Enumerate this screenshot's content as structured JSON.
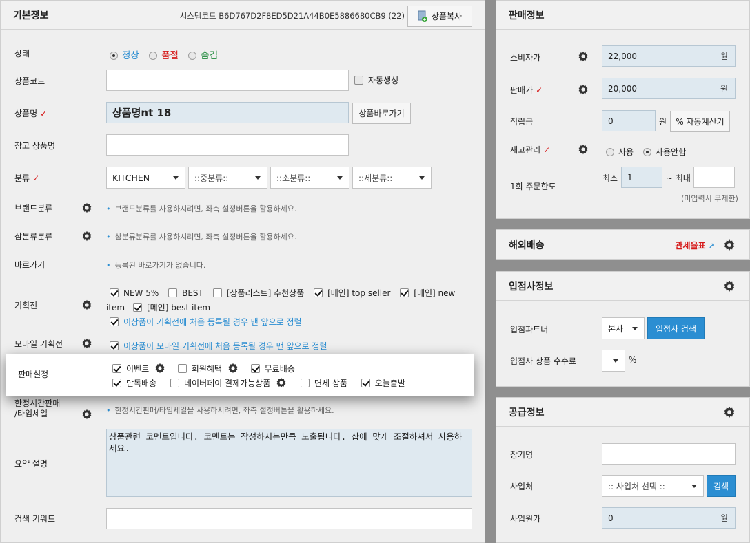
{
  "basic": {
    "title": "기본정보",
    "system_code": "시스템코드 B6D767D2F8ED5D21A44B0E5886680CB9 (22)",
    "copy_button": "상품복사",
    "status": {
      "label": "상태",
      "options": [
        "정상",
        "품절",
        "숨김"
      ],
      "selected": "정상"
    },
    "product_code": {
      "label": "상품코드",
      "value": "",
      "auto_label": "자동생성"
    },
    "product_name": {
      "label": "상품명",
      "value": "상품명nt 18",
      "goto_button": "상품바로가기"
    },
    "ref_name": {
      "label": "참고 상품명",
      "value": ""
    },
    "category": {
      "label": "분류",
      "selects": [
        "KITCHEN",
        "::중분류::",
        "::소분류::",
        "::세분류::"
      ]
    },
    "brand": {
      "label": "브랜드분류",
      "hint": "브랜드분류를 사용하시려면, 좌측 설정버튼을 활용하세요."
    },
    "sambun": {
      "label": "삼분류분류",
      "hint": "삼분류분류를 사용하시려면, 좌측 설정버튼을 활용하세요."
    },
    "shortcut": {
      "label": "바로가기",
      "hint": "등록된 바로가기가 없습니다."
    },
    "special": {
      "label": "기획전",
      "items": [
        {
          "label": "NEW 5%",
          "checked": true
        },
        {
          "label": "BEST",
          "checked": false
        },
        {
          "label": "[상품리스트] 추천상품",
          "checked": false
        },
        {
          "label": "[메인] top seller",
          "checked": true
        },
        {
          "label": "[메인] new",
          "checked": true
        }
      ],
      "wrap_text": "item",
      "second_item": "[메인] best item",
      "sort_note": "이상품이 기획전에 처음 등록될 경우 맨 앞으로 정렬"
    },
    "mobile_special": {
      "label": "모바일 기획전",
      "sort_note": "이상품이 모바일 기획전에 처음 등록될 경우 맨 앞으로 정렬"
    },
    "timesale": {
      "label_line1": "한정시간판매",
      "label_line2": "/타임세일",
      "hint": "한정시간판매/타임세일을 사용하시려면, 좌측 설정버튼을 활용하세요."
    },
    "summary": {
      "label": "요약 설명",
      "value": "상품관련 코멘트입니다. 코멘트는 작성하시는만큼 노출됩니다. 샵에 맞게 조절하셔서 사용하세요."
    },
    "keyword": {
      "label": "검색 키워드",
      "value": ""
    }
  },
  "sale_settings": {
    "label": "판매설정",
    "row1": [
      {
        "label": "이벤트",
        "checked": true,
        "gear": true
      },
      {
        "label": "회원혜택",
        "checked": false,
        "gear": true
      },
      {
        "label": "무료배송",
        "checked": true,
        "gear": false
      }
    ],
    "row2": [
      {
        "label": "단독배송",
        "checked": true,
        "gear": false
      },
      {
        "label": "네이버페이 결제가능상품",
        "checked": false,
        "gear": true
      },
      {
        "label": "면세 상품",
        "checked": false,
        "gear": false
      },
      {
        "label": "오늘출발",
        "checked": true,
        "gear": false
      }
    ]
  },
  "sales": {
    "title": "판매정보",
    "consumer_price": {
      "label": "소비자가",
      "value": "22,000",
      "unit": "원"
    },
    "sale_price": {
      "label": "판매가",
      "value": "20,000",
      "unit": "원"
    },
    "points": {
      "label": "적립금",
      "value": "0",
      "unit": "원",
      "auto_button": "% 자동계산기"
    },
    "stock": {
      "label": "재고관리",
      "options": [
        "사용",
        "사용안함"
      ],
      "selected": "사용안함"
    },
    "order_limit": {
      "label": "1회 주문한도",
      "min_label": "최소",
      "min_value": "1",
      "max_label": "~ 최대",
      "max_value": "",
      "note": "(미입력시 무제한)"
    }
  },
  "overseas": {
    "title": "해외배송",
    "tariff_link": "관세율표"
  },
  "vendor": {
    "title": "입점사정보",
    "partner": {
      "label": "입점파트너",
      "value": "본사",
      "search_button": "입점사 검색"
    },
    "fee": {
      "label": "입점사 상품 수수료",
      "value": "",
      "unit": "%"
    }
  },
  "supply": {
    "title": "공급정보",
    "ledger": {
      "label": "장기명",
      "value": ""
    },
    "supplier": {
      "label": "사입처",
      "value": ":: 사입처 선택 ::",
      "search_button": "검색"
    },
    "cost": {
      "label": "사입원가",
      "value": "0",
      "unit": "원"
    }
  },
  "colors": {
    "accent_blue": "#2b8ed2",
    "required_red": "#d61a1a",
    "status_green": "#1d8a3a",
    "panel_bg": "#efefef",
    "input_blue": "#dfe9f0"
  }
}
